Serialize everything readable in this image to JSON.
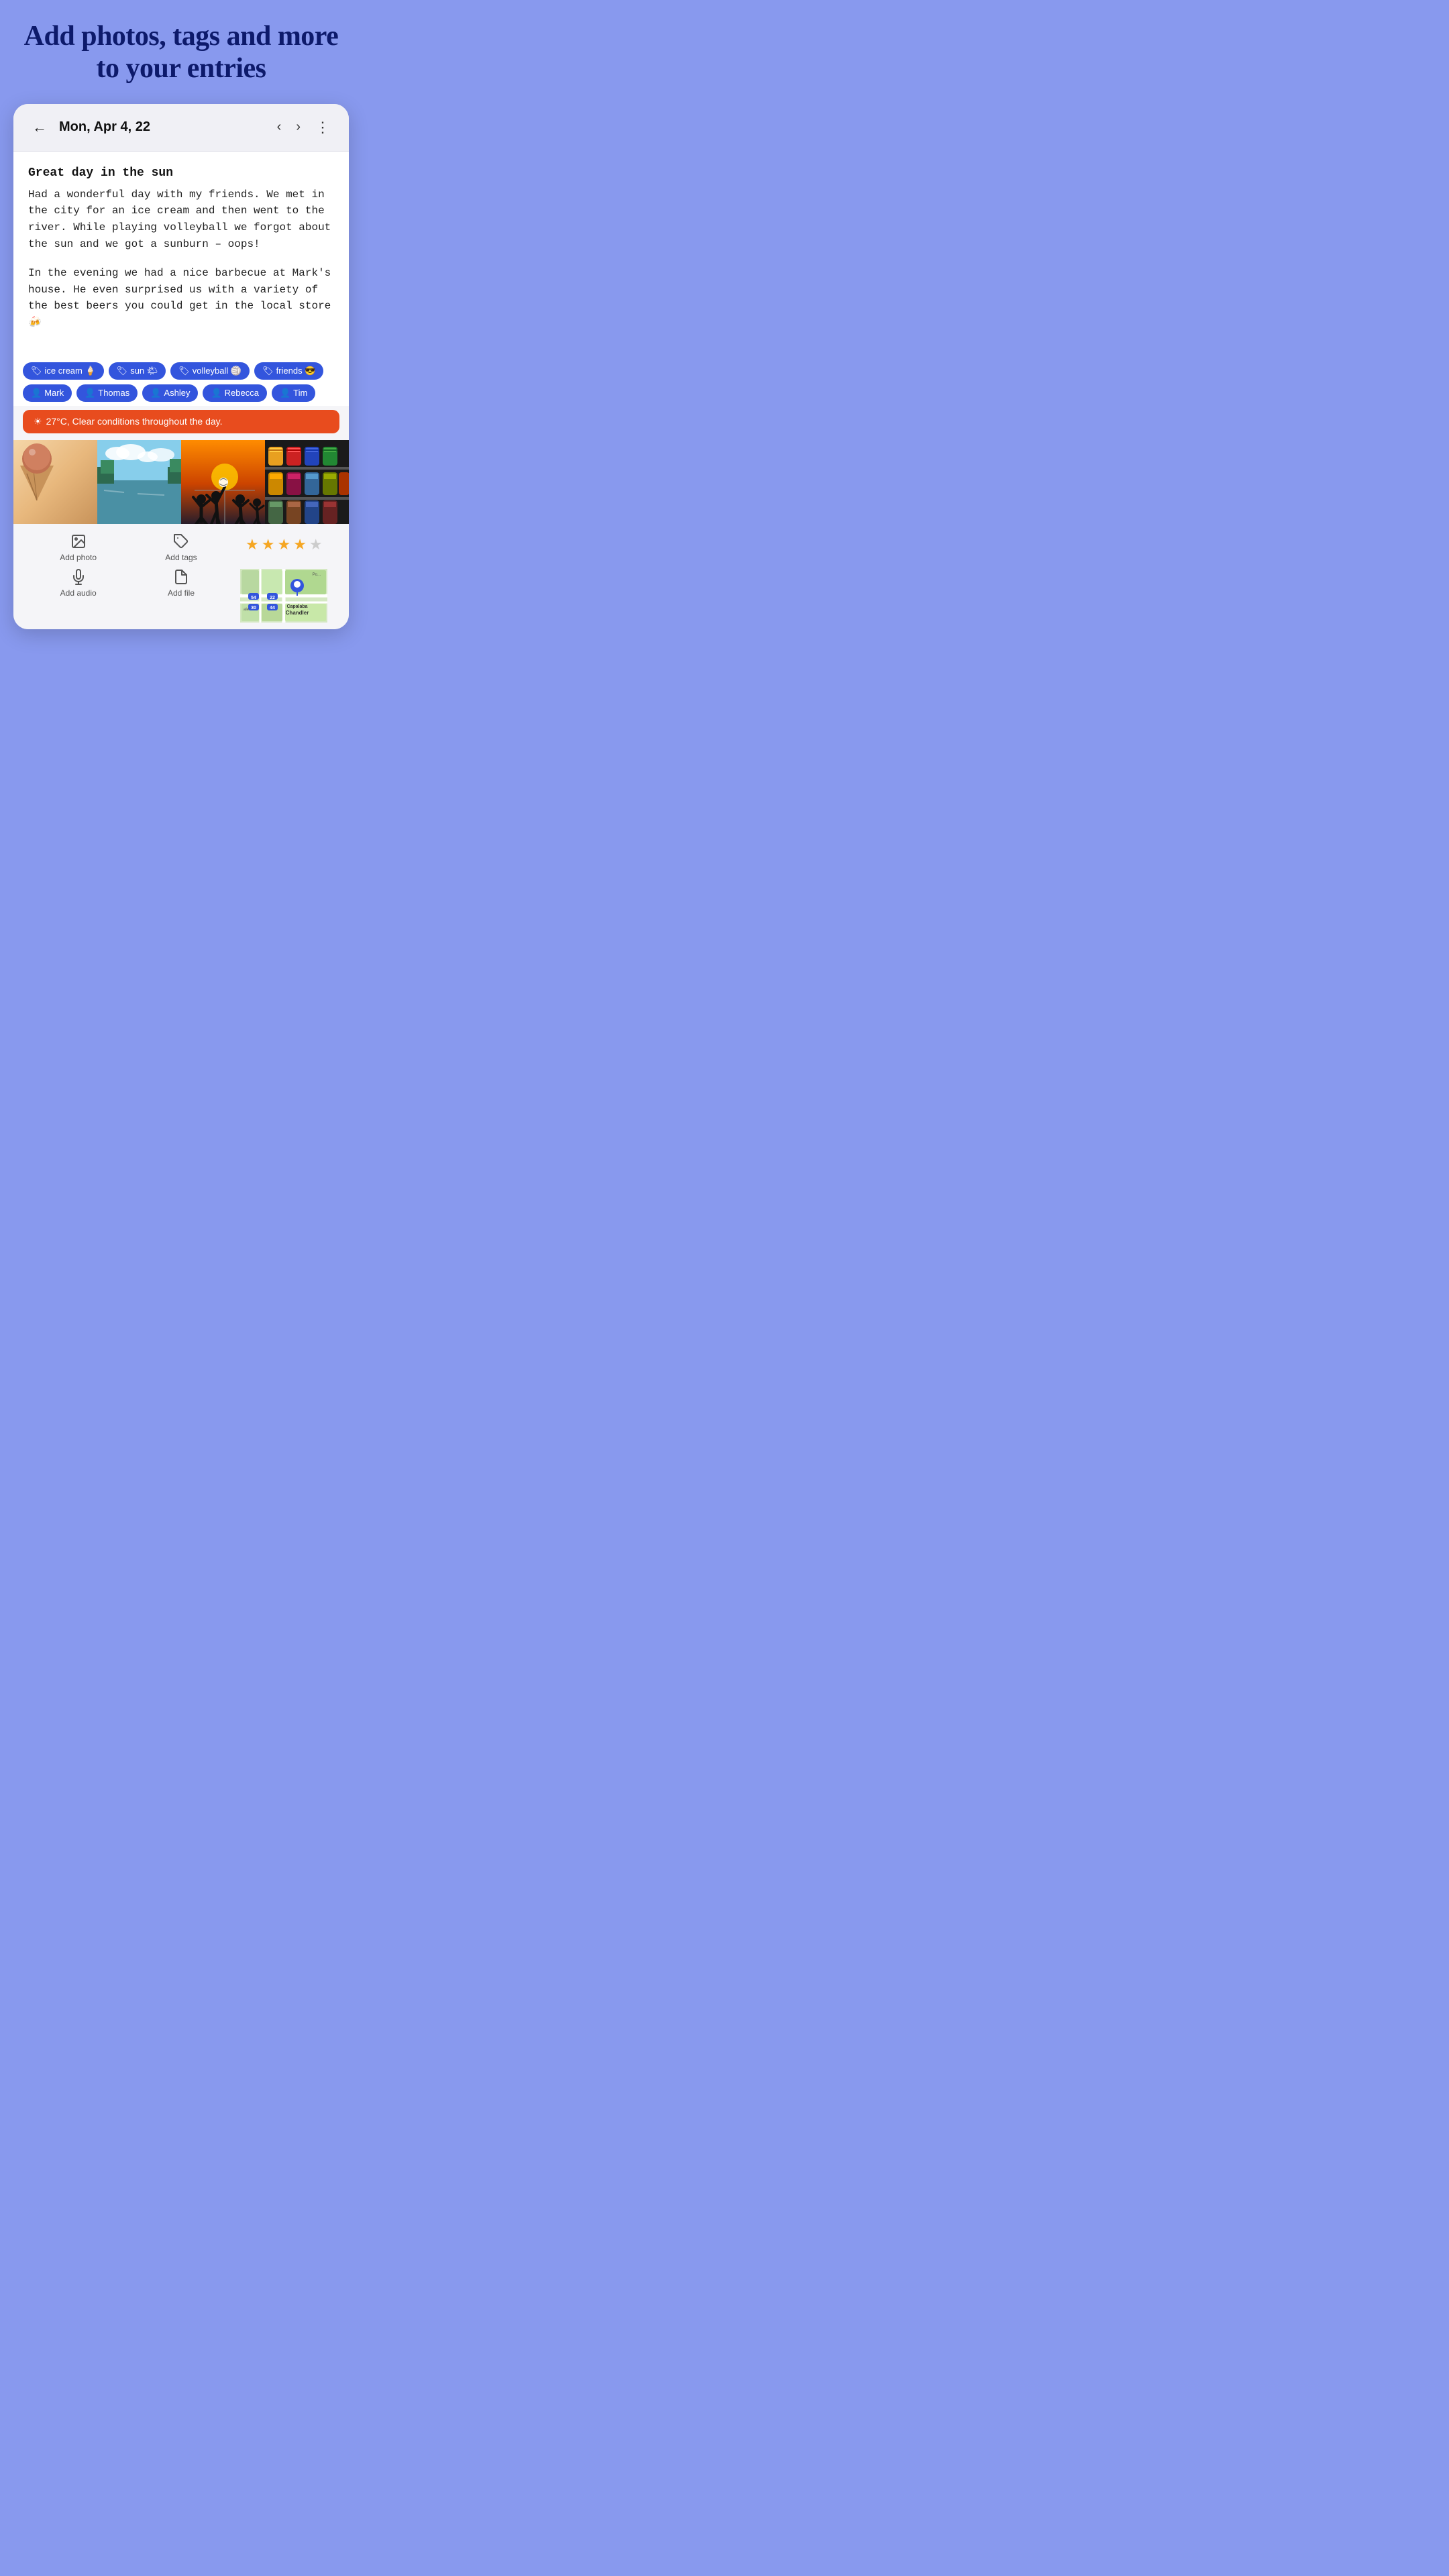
{
  "headline": "Add photos, tags and more to your entries",
  "header": {
    "date": "Mon, Apr 4, 22",
    "back_label": "←",
    "prev_label": "‹",
    "next_label": "›",
    "menu_label": "⋮"
  },
  "entry": {
    "title": "Great day in the sun",
    "paragraph1": "Had a wonderful day with my friends. We met in the city for an ice cream and then went to the river. While playing volleyball we forgot about the sun and we got a sunburn – oops!",
    "paragraph2": "In the evening we had a nice barbecue at Mark's house. He even surprised us with a variety of the best beers you could get in the local store 🍻"
  },
  "tags": [
    {
      "icon": "🏷",
      "label": "ice cream 🍦"
    },
    {
      "icon": "🏷",
      "label": "sun 🌤"
    },
    {
      "icon": "🏷",
      "label": "volleyball 🏐"
    },
    {
      "icon": "🏷",
      "label": "friends 😎"
    },
    {
      "icon": "👤",
      "label": "Mark"
    },
    {
      "icon": "👤",
      "label": "Thomas"
    },
    {
      "icon": "👤",
      "label": "Ashley"
    },
    {
      "icon": "👤",
      "label": "Rebecca"
    },
    {
      "icon": "👤",
      "label": "Tim"
    }
  ],
  "weather": {
    "icon": "☀",
    "text": "27°C, Clear conditions throughout the day."
  },
  "photos": [
    {
      "type": "icecream",
      "emoji": "🍦",
      "alt": "Ice cream cone"
    },
    {
      "type": "river",
      "emoji": "🌊",
      "alt": "River with trees"
    },
    {
      "type": "volleyball",
      "emoji": "🏐",
      "alt": "Volleyball silhouettes at sunset"
    },
    {
      "type": "beer",
      "emoji": "🍺",
      "alt": "Beer cans on shelf"
    }
  ],
  "toolbar": {
    "add_photo_label": "Add photo",
    "add_tags_label": "Add tags",
    "add_audio_label": "Add audio",
    "add_file_label": "Add file"
  },
  "rating": {
    "filled": 4,
    "empty": 1,
    "total": 5
  },
  "map": {
    "labels": [
      "Capalaba",
      "Chandler"
    ],
    "badge1": "54",
    "badge2": "22",
    "badge3": "30",
    "badge4": "44"
  },
  "colors": {
    "accent": "#3355dd",
    "weather_bg": "#e84c1e",
    "background": "#8899ee",
    "card_bg": "#ffffff"
  }
}
